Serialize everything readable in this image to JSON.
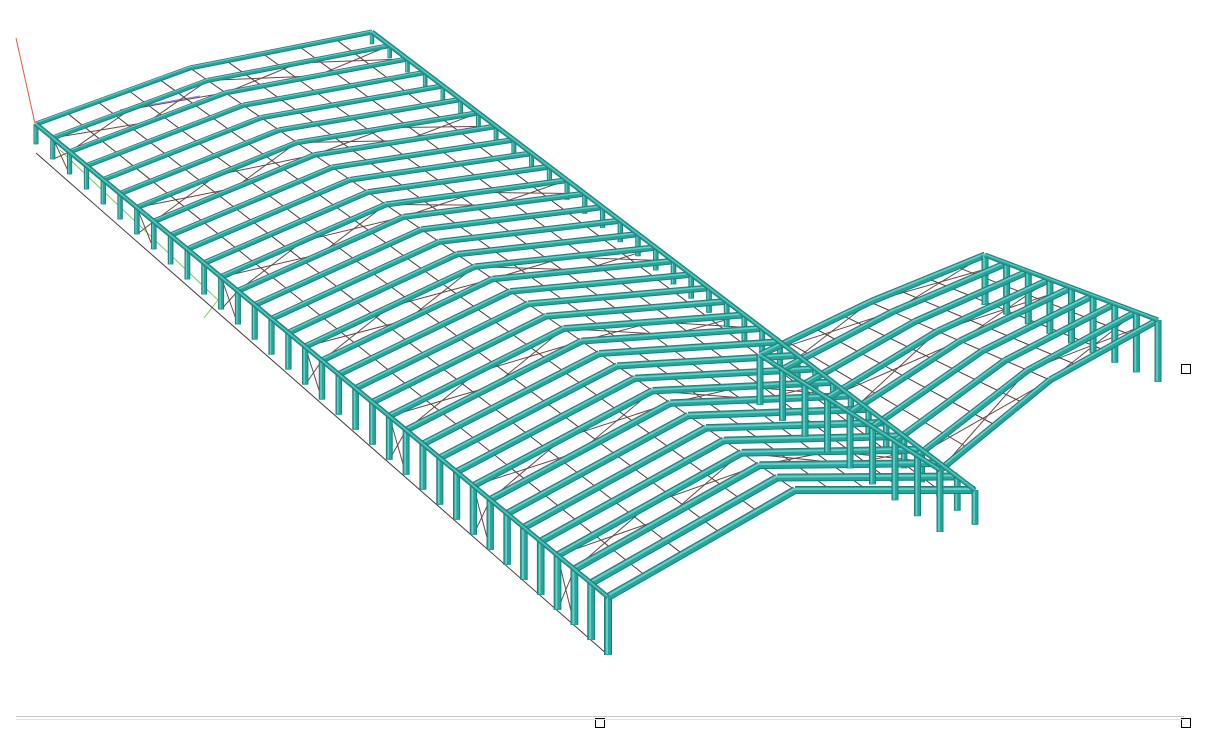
{
  "viewport": {
    "background": "#ffffff",
    "frame_color": "#2aa39b",
    "frame_shade": "#1f7f78",
    "frame_face": "#5fd1c8",
    "secondary_color": "#4a3a3a",
    "bracing_color": "#6b4545",
    "axis_x_color": "#e05a4a",
    "axis_y_color": "#6ccf5a",
    "axis_z_color": "#7a7aff"
  },
  "controls": {
    "resize_handles": [
      "right-edge-handle",
      "bottom-edge-handle",
      "corner-handle"
    ],
    "scrollbar": "horizontal"
  }
}
